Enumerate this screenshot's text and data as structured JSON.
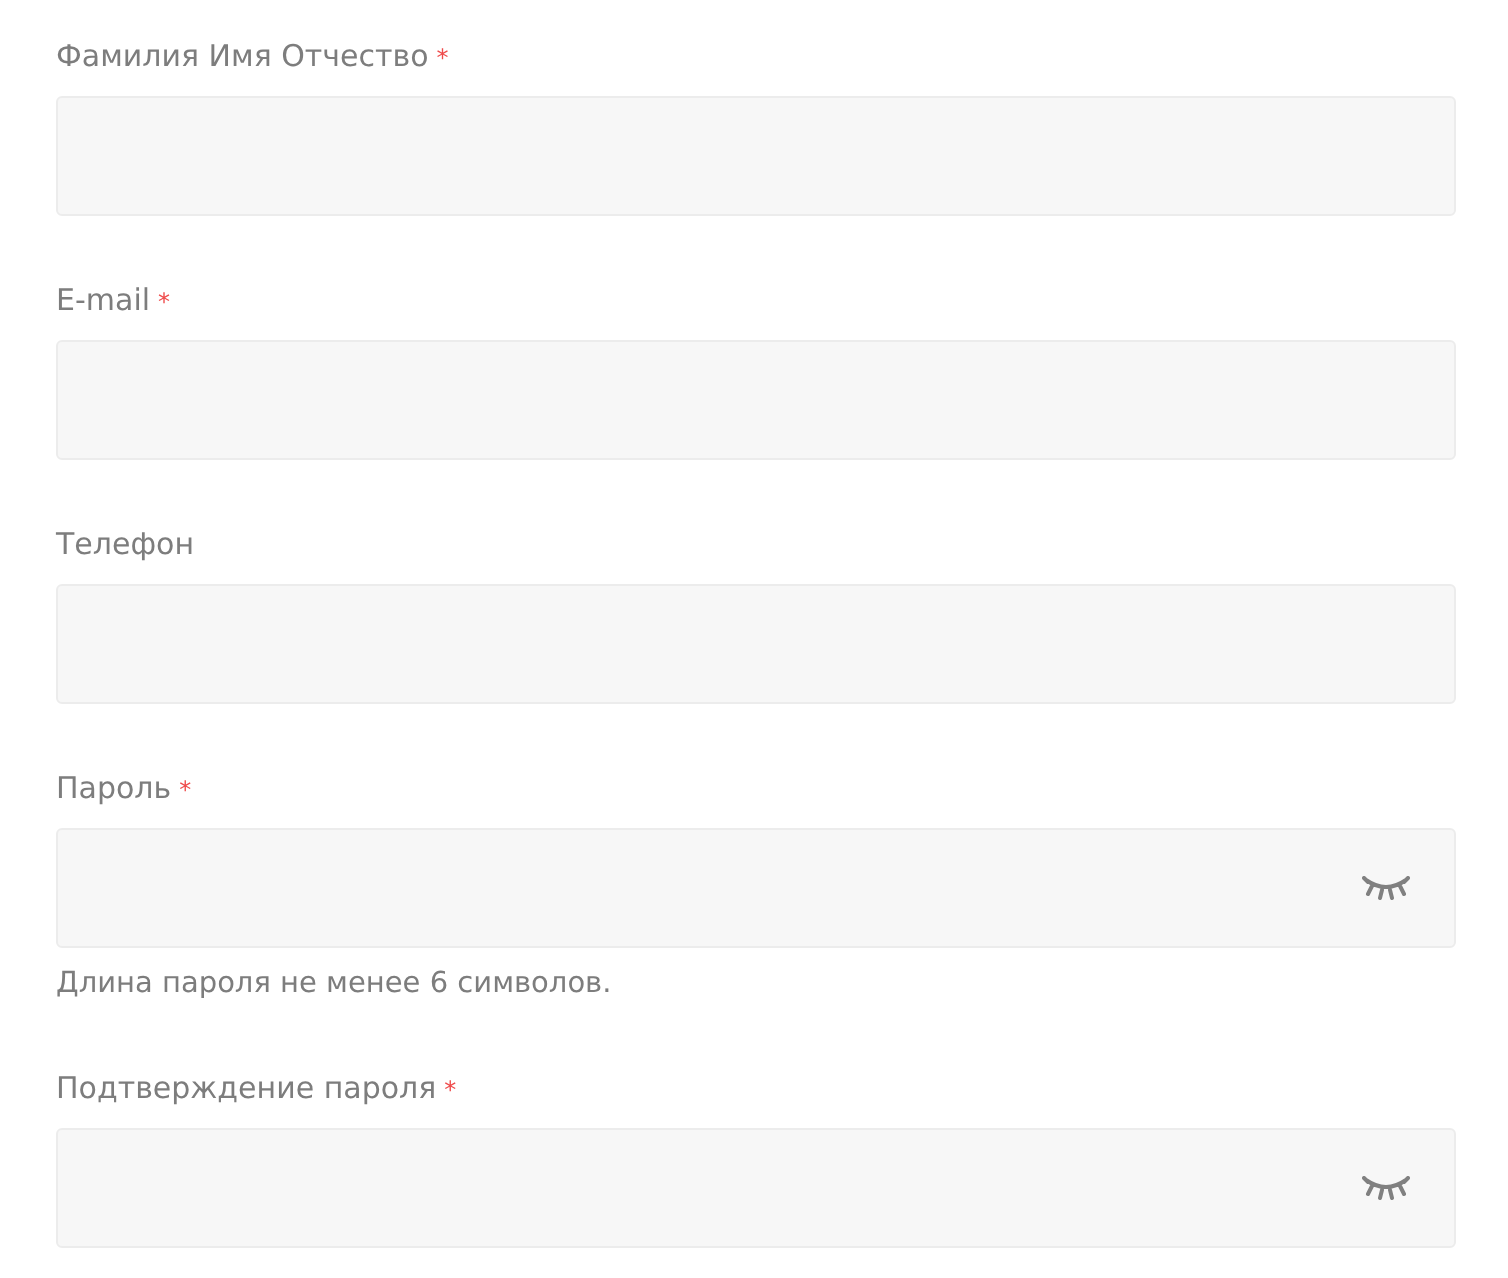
{
  "fields": [
    {
      "label": "Фамилия Имя Отчество",
      "required_mark": "*",
      "kind": "text"
    },
    {
      "label": "E-mail",
      "required_mark": "*",
      "kind": "text"
    },
    {
      "label": "Телефон",
      "kind": "text"
    },
    {
      "label": "Пароль",
      "required_mark": "*",
      "kind": "password",
      "masked": true,
      "hint": "Длина пароля не менее 6 символов."
    },
    {
      "label": "Подтверждение пароля",
      "required_mark": "*",
      "kind": "password",
      "masked": true
    }
  ]
}
